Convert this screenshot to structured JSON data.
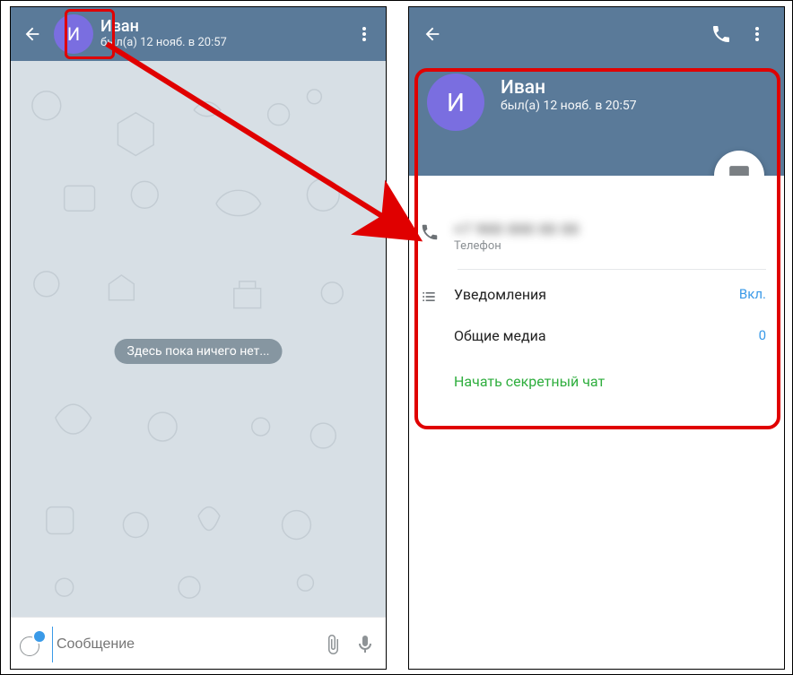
{
  "chat": {
    "avatar_letter": "И",
    "title": "Иван",
    "status": "был(а) 12 нояб. в 20:57",
    "empty_label": "Здесь пока ничего нет...",
    "input_placeholder": "Сообщение"
  },
  "profile": {
    "avatar_letter": "И",
    "name": "Иван",
    "status": "был(а) 12 нояб. в 20:57",
    "phone_masked": "+7 900 000 00 00",
    "phone_label": "Телефон",
    "notifications_label": "Уведомления",
    "notifications_value": "Вкл.",
    "shared_media_label": "Общие медиа",
    "shared_media_value": "0",
    "secret_chat_label": "Начать секретный чат"
  }
}
